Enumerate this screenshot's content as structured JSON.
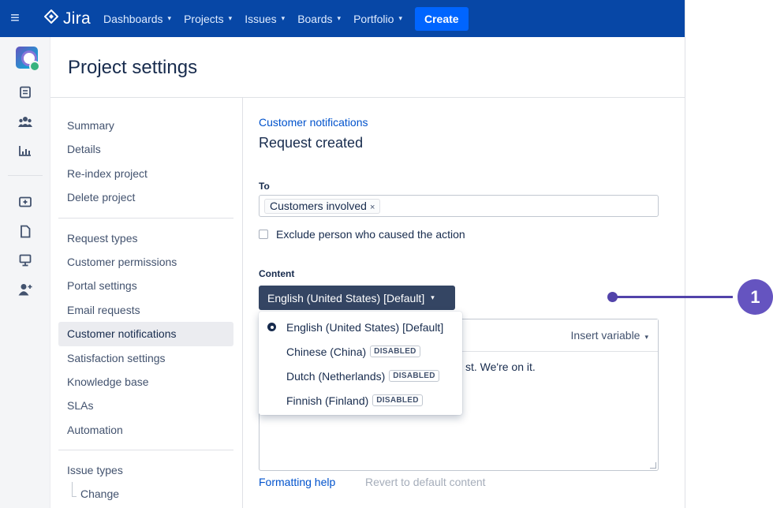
{
  "topnav": {
    "menu_icon": "hamburger-icon",
    "logo_text": "Jira",
    "items": [
      {
        "label": "Dashboards"
      },
      {
        "label": "Projects"
      },
      {
        "label": "Issues"
      },
      {
        "label": "Boards"
      },
      {
        "label": "Portfolio"
      }
    ],
    "create_label": "Create",
    "bg_color": "#0747a6"
  },
  "iconbar": {
    "icons": [
      "project-avatar-icon",
      "backlog-icon",
      "people-icon",
      "reports-icon",
      "add-item-icon",
      "page-icon",
      "monitor-icon",
      "add-person-icon"
    ]
  },
  "page": {
    "title": "Project settings"
  },
  "settings_nav": {
    "group1": [
      "Summary",
      "Details",
      "Re-index project",
      "Delete project"
    ],
    "group2": [
      "Request types",
      "Customer permissions",
      "Portal settings",
      "Email requests",
      "Customer notifications",
      "Satisfaction settings",
      "Knowledge base",
      "SLAs",
      "Automation"
    ],
    "group3": [
      "Issue types"
    ],
    "sub": [
      "Change"
    ],
    "active": "Customer notifications"
  },
  "main": {
    "breadcrumb": "Customer notifications",
    "title": "Request created",
    "to_label": "To",
    "to_chip": "Customers involved",
    "to_chip_remove": "×",
    "exclude_label": "Exclude person who caused the action",
    "content_label": "Content",
    "language_button": "English (United States) [Default]",
    "insert_variable": "Insert variable",
    "editor_text_visible": "st. We're on it.",
    "formatting_help": "Formatting help",
    "revert": "Revert to default content"
  },
  "dropdown": {
    "items": [
      {
        "label": "English (United States) [Default]",
        "selected": true,
        "badge": ""
      },
      {
        "label": "Chinese (China)",
        "selected": false,
        "badge": "DISABLED"
      },
      {
        "label": "Dutch (Netherlands)",
        "selected": false,
        "badge": "DISABLED"
      },
      {
        "label": "Finnish (Finland)",
        "selected": false,
        "badge": "DISABLED"
      }
    ]
  },
  "callout": {
    "number": "1",
    "color": "#6554c0"
  }
}
